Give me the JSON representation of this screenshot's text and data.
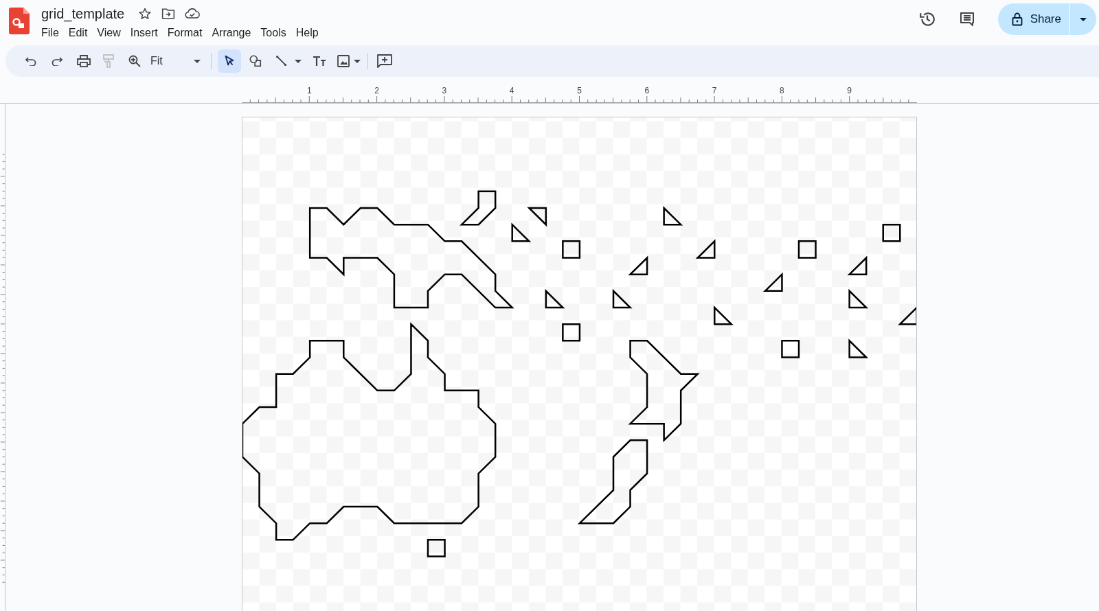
{
  "document": {
    "title": "grid_template"
  },
  "menu": [
    "File",
    "Edit",
    "View",
    "Insert",
    "Format",
    "Arrange",
    "Tools",
    "Help"
  ],
  "share_button": {
    "label": "Share"
  },
  "toolbar": {
    "zoom": "Fit",
    "tools": [
      {
        "kind": "select",
        "selected": true
      },
      {
        "kind": "shape",
        "selected": false
      },
      {
        "kind": "line",
        "selected": false
      }
    ]
  },
  "ruler": {
    "labels": [
      "1",
      "2",
      "3",
      "4",
      "5",
      "6",
      "7",
      "8",
      "9"
    ]
  }
}
